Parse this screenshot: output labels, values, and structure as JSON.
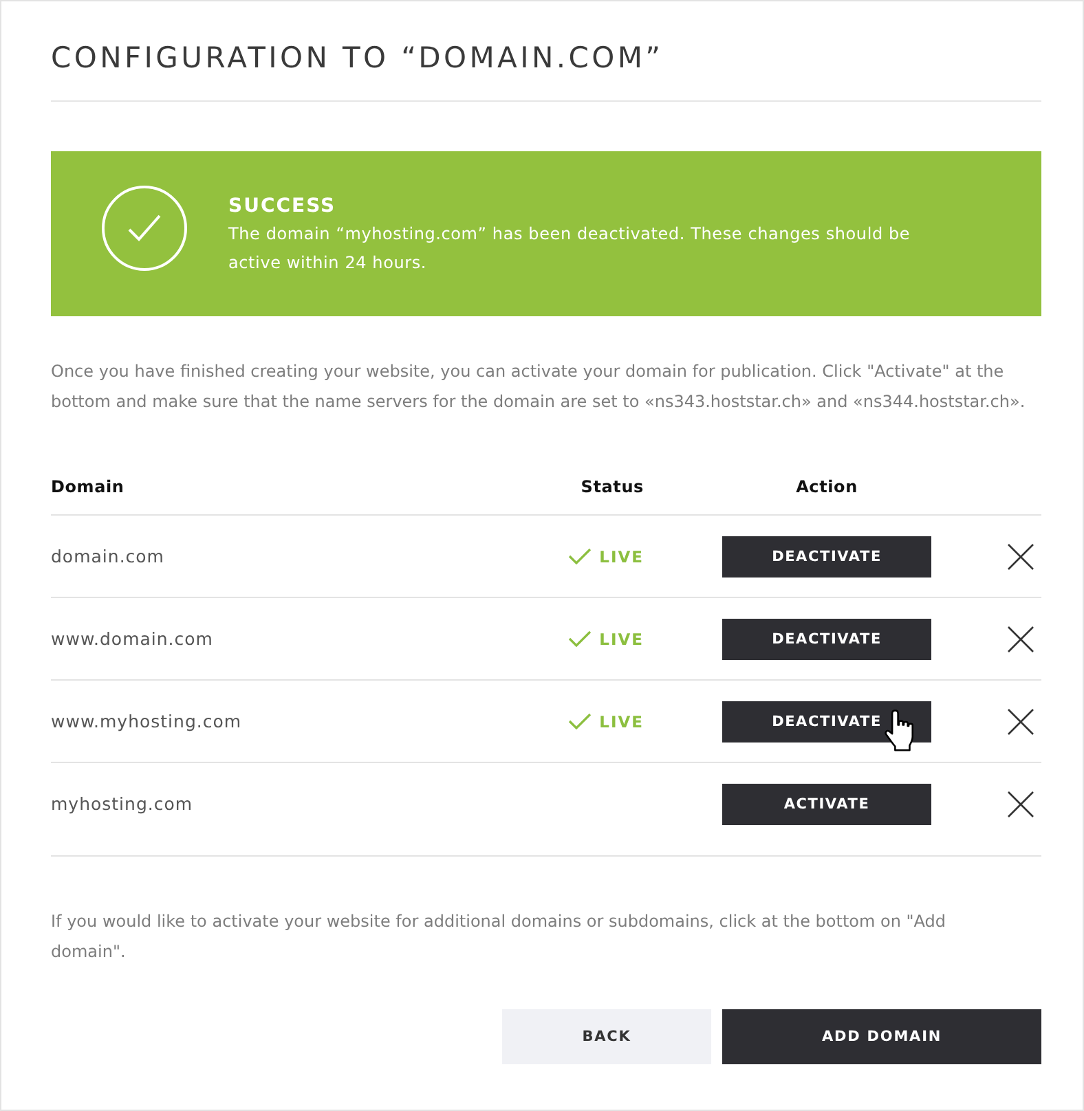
{
  "title": "CONFIGURATION TO “DOMAIN.COM”",
  "alert": {
    "kind": "success",
    "heading": "SUCCESS",
    "message": "The domain “myhosting.com” has been deactivated. These changes should be active within 24 hours."
  },
  "intro": "Once you have finished creating your website, you can activate your domain for publication. Click \"Activate\" at the bottom and make sure that the name servers for the domain are set to «ns343.hoststar.ch» and «ns344.hoststar.ch».",
  "table": {
    "columns": [
      "Domain",
      "Status",
      "Action"
    ],
    "rows": [
      {
        "domain": "domain.com",
        "status": "LIVE",
        "action": "DEACTIVATE",
        "hovered": false
      },
      {
        "domain": "www.domain.com",
        "status": "LIVE",
        "action": "DEACTIVATE",
        "hovered": false
      },
      {
        "domain": "www.myhosting.com",
        "status": "LIVE",
        "action": "DEACTIVATE",
        "hovered": true
      },
      {
        "domain": "myhosting.com",
        "action": "ACTIVATE",
        "hovered": false
      }
    ]
  },
  "note": "If you would like to activate your website for additional domains or subdomains, click at the bottom on \"Add domain\".",
  "buttons": [
    {
      "label": "BACK",
      "kind": "secondary"
    },
    {
      "label": "ADD DOMAIN",
      "kind": "primary"
    }
  ]
}
